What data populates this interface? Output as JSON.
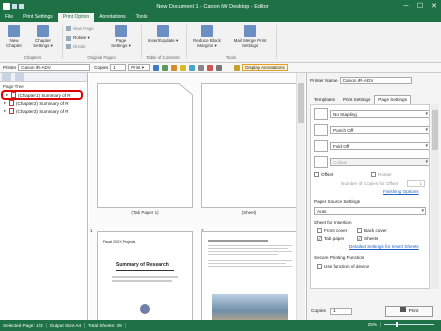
{
  "window": {
    "title": "New Document 1 - Canon iW Desktop - Editor",
    "minimize": "─",
    "maximize": "☐",
    "close": "✕"
  },
  "ribbon_tabs": [
    "File",
    "Print Settings",
    "Print Option",
    "Annotations",
    "Tools"
  ],
  "ribbon": {
    "new_chapter": "New Chapter",
    "chapter_settings": "Chapter Settings ▾",
    "chapters_group": "Chapters",
    "new_page": "New Page",
    "rotate": "Rotate ▾",
    "divide": "Divide",
    "page_settings": "Page Settings ▾",
    "original_pages_group": "Original Pages",
    "insert_update": "Insert/Update ▾",
    "toc_group": "Table of Contents",
    "reduce_margins": "Reduce Block Margins ▾",
    "mail_merge": "Mail Merge Print Settings",
    "tools_group": "Tools"
  },
  "toolbar": {
    "printer_label": "Printer",
    "printer_value": "Canon iR-ADV",
    "copies_label": "Copies",
    "copies_value": "1",
    "print_label": "Print ▾",
    "display_annotations": "Display Annotations"
  },
  "left_pane": {
    "title": "Page Tree",
    "items": [
      {
        "label": "(Chapter1) Summary of R",
        "selected": true
      },
      {
        "label": "(Chapter2) Summary of R"
      },
      {
        "label": "(Chapter3) Summary of R"
      }
    ]
  },
  "canvas": {
    "page1_label": "(Tab Paper 1)",
    "page2_label": "(Sheet)",
    "page3_num": "1",
    "page4_num": "2",
    "page3_title": "Summary of Research",
    "page3_header": "Fiscal 20XX Projects"
  },
  "right_pane": {
    "printer_label": "Printer Name",
    "printer_value": "Canon iR-ADV",
    "tabs": [
      "Templates",
      "Print Settings",
      "Page Settings"
    ],
    "stapling": "No Stapling",
    "punch": "Punch Off",
    "fold": "Fold Off",
    "collate": "Collate",
    "offset": "Offset",
    "rotate": "Rotate",
    "copies_offset": "Number of Copies for Offset",
    "copies_offset_value": "1",
    "finishing": "Finishing Options",
    "paper_source_title": "Paper Source Settings",
    "paper_source": "Auto",
    "sheet_insert_title": "Sheet for Insertion",
    "front_cover": "Front cover",
    "back_cover": "Back cover",
    "tab_paper": "Tab paper",
    "sheets": "Sheets",
    "detailed_sheets": "Detailed Settings for Insert Sheets",
    "secure_title": "Secure Printing Function",
    "use_device": "Use function of device",
    "copies_label": "Copies",
    "copies_value": "1",
    "print_button": "Print"
  },
  "status": {
    "selected_page": "Selected Page: 1/3",
    "output_size": "Output Size:A4",
    "total_sheets": "Total Sheets: 39",
    "zoom": "25%"
  },
  "colors": {
    "accent": "#1e7145",
    "highlight": "#e00000",
    "link": "#1f5fbf"
  }
}
